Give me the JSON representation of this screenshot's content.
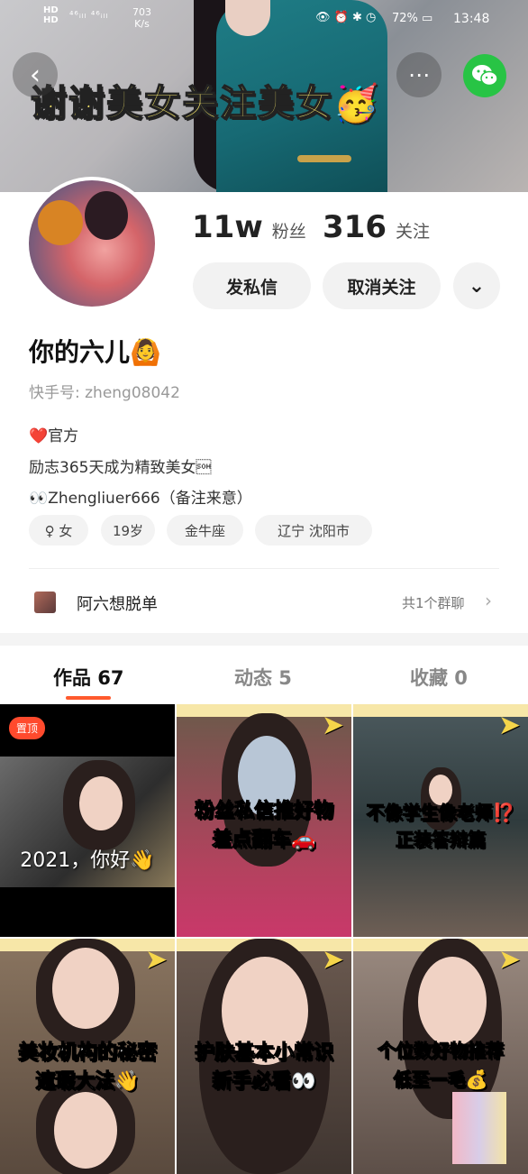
{
  "status_bar": {
    "hd_top": "HD",
    "hd_bottom": "HD",
    "signal": "⁴⁶ᵢₗₗ ⁴⁶ᵢₗₗ",
    "speed": "703",
    "speed_unit": "K/s",
    "icons": "👁 ⏰ ✱ ◷",
    "battery": "72%",
    "time": "13:48"
  },
  "banner": {
    "text": "谢谢美女关注美女🥳",
    "back_icon": "‹",
    "more_icon": "⋯"
  },
  "profile": {
    "followers_value": "11w",
    "followers_label": "粉丝",
    "following_value": "316",
    "following_label": "关注",
    "message_button": "发私信",
    "unfollow_button": "取消关注",
    "more_button": "⌄",
    "name": "你的六儿🙆",
    "kwai_id": "快手号: zheng08042",
    "bio_line1": "❤️官方",
    "bio_line2": "励志365天成为精致美女\u0001",
    "bio_line3": "👀Zhengliuer666（备注来意）",
    "tags": [
      "♀ 女",
      "19岁",
      "金牛座",
      "辽宁 沈阳市"
    ]
  },
  "group": {
    "name": "阿六想脱单",
    "count": "共1个群聊",
    "chevron": "›"
  },
  "tabs": [
    {
      "label": "作品 67"
    },
    {
      "label": "动态 5"
    },
    {
      "label": "收藏 0"
    }
  ],
  "videos": [
    {
      "pin": "置顶",
      "caption": "2021，你好👋"
    },
    {
      "caption": "粉丝私信推好物",
      "caption2": "差点翻车🚗"
    },
    {
      "caption": "不像学生像老师⁉️",
      "caption2": "正装答辩篇"
    },
    {
      "caption": "美妆机构的秘密",
      "caption2": "遮瑕大法👋"
    },
    {
      "caption": "护肤基本小常识",
      "caption2": "新手必看👀"
    },
    {
      "caption": "个位数好物推荐",
      "caption2": "低至一毛💰"
    }
  ],
  "colors": {
    "accent": "#ff5a2d",
    "wechat": "#28c445",
    "banner_text": "#f4e46a"
  }
}
